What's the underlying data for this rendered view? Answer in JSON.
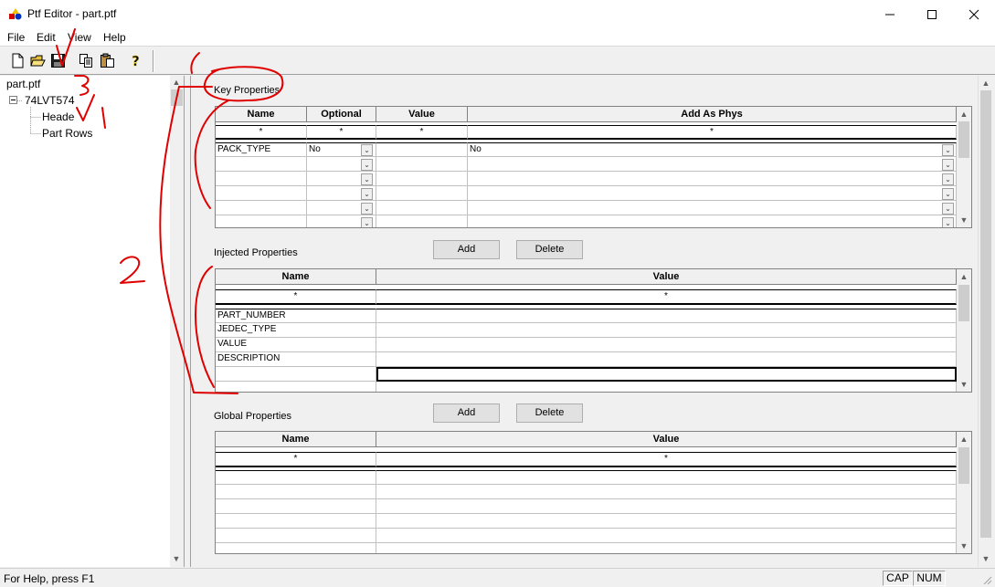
{
  "window": {
    "title": "Ptf Editor - part.ptf"
  },
  "menu": [
    "File",
    "Edit",
    "View",
    "Help"
  ],
  "toolbar": {
    "icons": [
      "new-file-icon",
      "open-folder-icon",
      "save-icon",
      "copy-icon",
      "paste-icon",
      "help-icon"
    ]
  },
  "tree": {
    "root": "part.ptf",
    "part": "74LVT574",
    "children": [
      "Header",
      "Part Rows"
    ]
  },
  "key_properties": {
    "label": "Key Properties",
    "columns": [
      "Name",
      "Optional",
      "Value",
      "Add As Phys"
    ],
    "filter": [
      "*",
      "*",
      "*",
      "*"
    ],
    "rows": [
      {
        "name": "PACK_TYPE",
        "optional": "No",
        "value": "",
        "phys": "No"
      }
    ]
  },
  "injected_properties": {
    "label": "Injected Properties",
    "add": "Add",
    "delete": "Delete",
    "columns": [
      "Name",
      "Value"
    ],
    "filter": [
      "*",
      "*"
    ],
    "rows": [
      "PART_NUMBER",
      "JEDEC_TYPE",
      "VALUE",
      "DESCRIPTION"
    ]
  },
  "global_properties": {
    "label": "Global Properties",
    "add": "Add",
    "delete": "Delete",
    "columns": [
      "Name",
      "Value"
    ],
    "filter": [
      "*",
      "*"
    ]
  },
  "status": {
    "help": "For Help, press F1",
    "cap": "CAP",
    "num": "NUM"
  },
  "annotations": [
    "1",
    "2",
    "3"
  ],
  "colors": {
    "annotation": "#e00000"
  }
}
